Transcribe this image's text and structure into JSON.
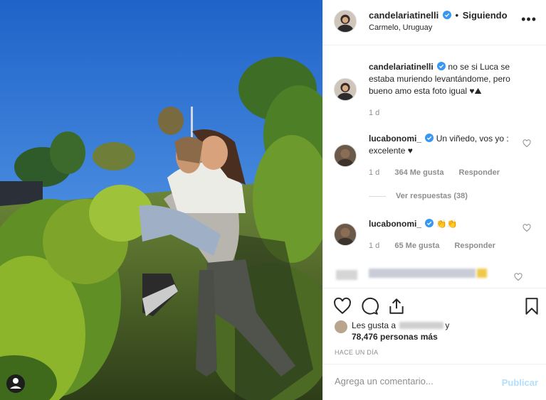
{
  "header": {
    "username": "candelariatinelli",
    "separator": "•",
    "follow_status": "Siguiendo",
    "location": "Carmelo, Uruguay",
    "more": "•••"
  },
  "comments": [
    {
      "username": "candelariatinelli",
      "text": "no se si Luca se estaba muriendo levantándome, pero bueno amo esta foto igual ♥⛰",
      "time": "1 d"
    },
    {
      "username": "lucabonomi_",
      "text": "Un viñedo, vos yo : excelente ♥",
      "time": "1 d",
      "likes": "364 Me gusta",
      "reply": "Responder",
      "view_replies": "Ver respuestas (38)"
    },
    {
      "username": "lucabonomi_",
      "text": "👏👏",
      "time": "1 d",
      "likes": "65 Me gusta",
      "reply": "Responder"
    }
  ],
  "likes": {
    "prefix": "Les gusta a",
    "suffix": "y",
    "count_text": "78,476 personas más"
  },
  "timestamp": "HACE UN DÍA",
  "add_comment": {
    "placeholder": "Agrega un comentario...",
    "publish": "Publicar"
  },
  "icons": [
    "heart-icon",
    "comment-icon",
    "share-icon",
    "bookmark-icon",
    "verified-badge-icon",
    "more-options-icon"
  ],
  "colors": {
    "verified": "#3897f0",
    "publish_disabled": "#b2dffc",
    "meta_text": "#8e8e8e",
    "heart_red": "#ed4956"
  }
}
